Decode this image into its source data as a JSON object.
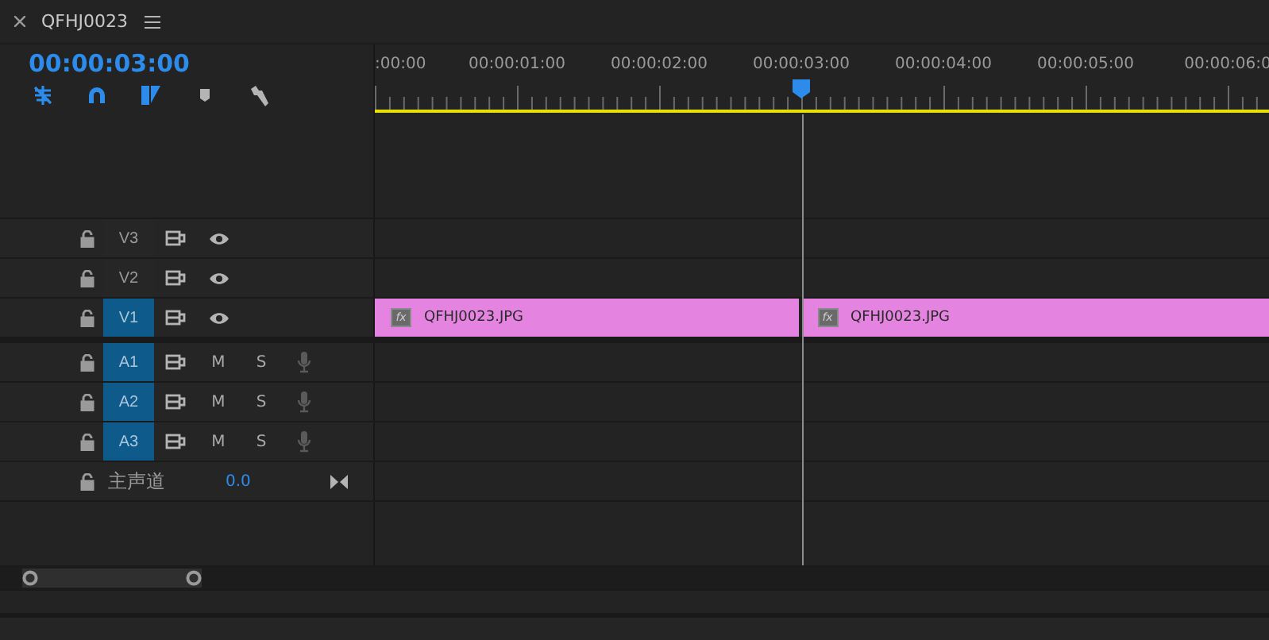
{
  "panel_tab": {
    "title": "QFHJ0023"
  },
  "timecode": "00:00:03:00",
  "tools": [
    {
      "kind": "nest",
      "on": true
    },
    {
      "kind": "snap",
      "on": true
    },
    {
      "kind": "linked",
      "on": true
    },
    {
      "kind": "marker",
      "on": false
    },
    {
      "kind": "settings",
      "on": false
    }
  ],
  "ruler": {
    "labels": [
      ":00:00",
      "00:00:01:00",
      "00:00:02:00",
      "00:00:03:00",
      "00:00:04:00",
      "00:00:05:00",
      "00:00:06:0"
    ]
  },
  "playhead": {
    "level": 0.477
  },
  "tracks": [
    {
      "kind": "video",
      "name": "V3",
      "selected": false
    },
    {
      "kind": "video",
      "name": "V2",
      "selected": false
    },
    {
      "kind": "video",
      "name": "V1",
      "selected": true,
      "clips": [
        {
          "badge": "fx",
          "name": "QFHJ0023.JPG"
        },
        {
          "badge": "fx",
          "name": "QFHJ0023.JPG"
        }
      ]
    },
    {
      "kind": "audio",
      "name": "A1",
      "selected": true,
      "mute": "M",
      "solo": "S"
    },
    {
      "kind": "audio",
      "name": "A2",
      "selected": true,
      "mute": "M",
      "solo": "S"
    },
    {
      "kind": "audio",
      "name": "A3",
      "selected": true,
      "mute": "M",
      "solo": "S"
    },
    {
      "kind": "master",
      "name": "主声道",
      "value": "0.0"
    }
  ]
}
